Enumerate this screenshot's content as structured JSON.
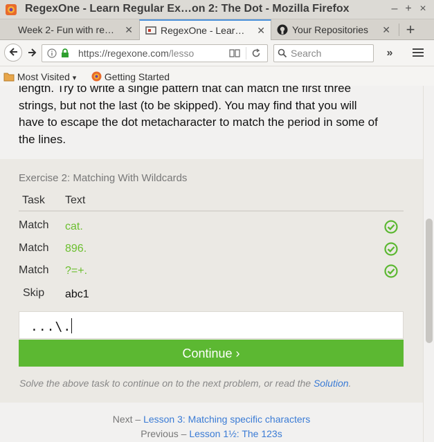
{
  "window": {
    "title": "RegexOne - Learn Regular Ex…on 2: The Dot - Mozilla Firefox",
    "controls": {
      "minimize": "–",
      "maximize": "+",
      "close": "×"
    }
  },
  "tabs": [
    {
      "label": "Week 2- Fun with re…",
      "active": false
    },
    {
      "label": "RegexOne - Lear…",
      "active": true
    },
    {
      "label": "Your Repositories",
      "active": false
    }
  ],
  "toolbar": {
    "url_host": "https://regexone.com",
    "url_path": "/lesso",
    "search_placeholder": "Search"
  },
  "bookmarks": [
    {
      "label": "Most Visited",
      "has_dropdown": true
    },
    {
      "label": "Getting Started"
    }
  ],
  "lesson": {
    "paragraph_lines": [
      "length. Try to write a single pattern that can match the first three",
      "strings, but not the last (to be skipped). You may find that you will",
      "have to escape the dot metacharacter to match the period in some of",
      "the lines."
    ]
  },
  "exercise": {
    "title": "Exercise 2: Matching With Wildcards",
    "headers": {
      "task": "Task",
      "text": "Text"
    },
    "rows": [
      {
        "task": "Match",
        "text": "cat.",
        "passed": true
      },
      {
        "task": "Match",
        "text": "896.",
        "passed": true
      },
      {
        "task": "Match",
        "text": "?=+.",
        "passed": true
      },
      {
        "task": "Skip",
        "text": "abc1",
        "passed": false
      }
    ],
    "answer_value": "...\\.",
    "continue_label": "Continue ›",
    "hint_prefix": "Solve the above task to continue on to the next problem, or read the ",
    "hint_link": "Solution",
    "hint_suffix": "."
  },
  "pagination": {
    "next_prefix": "Next – ",
    "next_link": "Lesson 3: Matching specific characters",
    "prev_prefix": "Previous – ",
    "prev_link": "Lesson 1½: The 123s"
  },
  "colors": {
    "accent_green": "#5cb832",
    "match_text": "#6bbf2e",
    "link": "#3a7bd5"
  }
}
